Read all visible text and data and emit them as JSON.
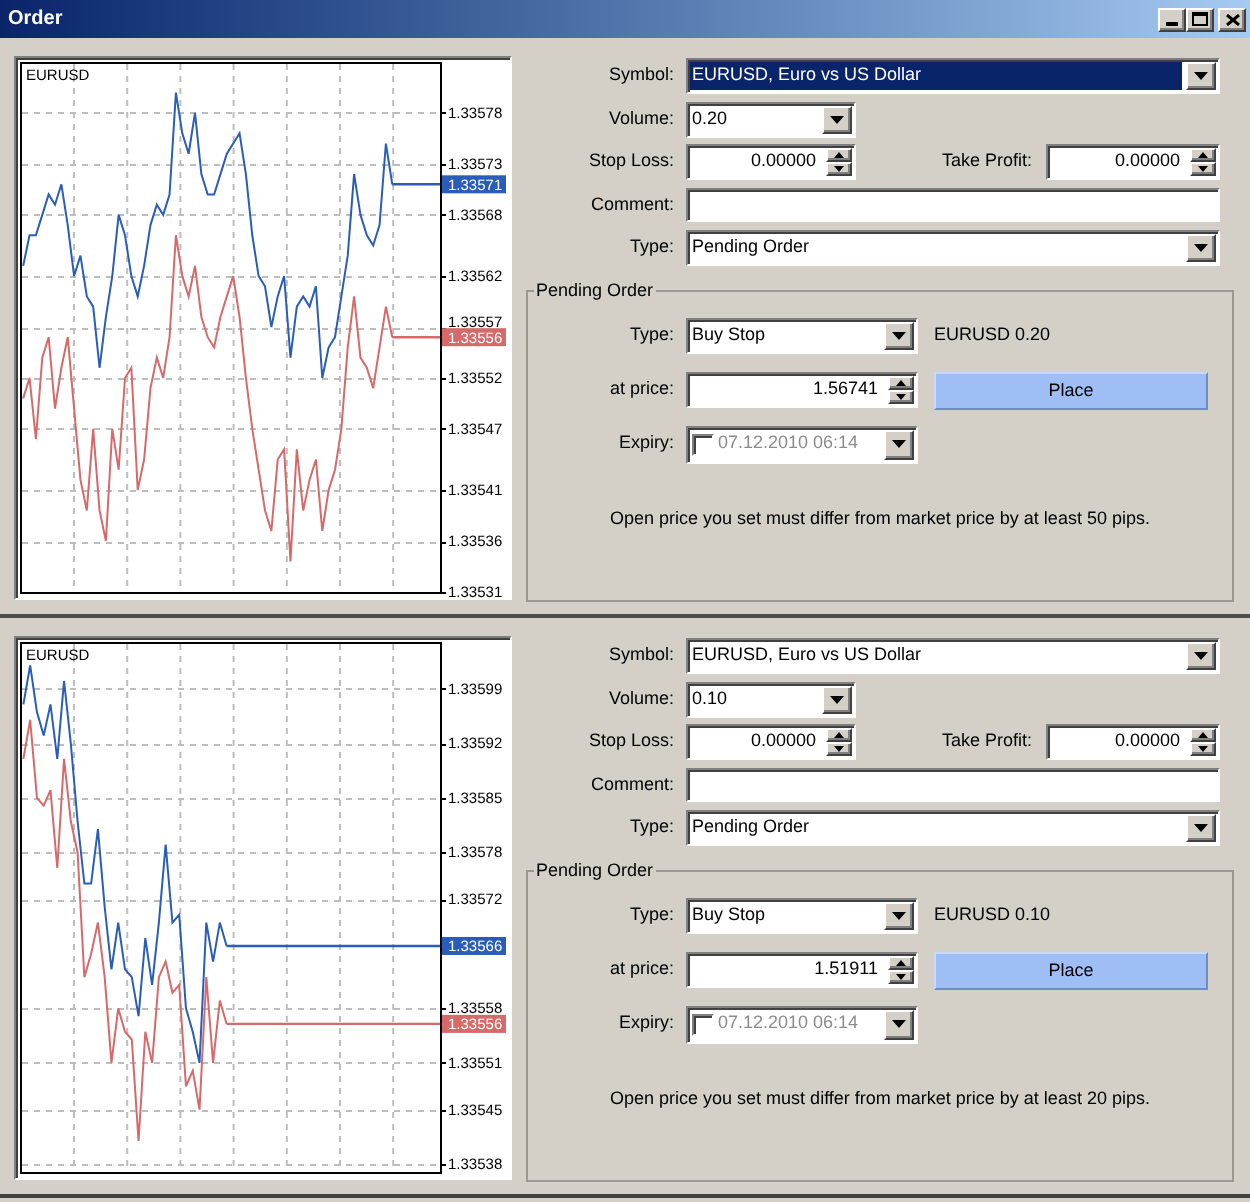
{
  "window": {
    "title": "Order"
  },
  "panels": [
    {
      "chart": {
        "chart_data": {
          "type": "line",
          "title": "EURUSD",
          "grid": true,
          "categories": [
            null,
            null,
            null,
            null,
            null,
            null,
            null,
            null,
            null,
            null,
            null,
            null,
            null,
            null,
            null,
            null,
            null,
            null,
            null,
            null,
            null,
            null,
            null,
            null,
            null,
            null,
            null,
            null,
            null,
            null,
            null,
            null,
            null,
            null,
            null,
            null,
            null,
            null,
            null,
            null,
            null,
            null,
            null,
            null,
            null,
            null,
            null,
            null,
            null,
            null,
            null,
            null,
            null,
            null,
            null,
            null,
            null,
            null,
            null,
            null,
            null,
            null,
            null,
            null,
            null,
            null
          ],
          "ylim": [
            1.33531,
            1.33583
          ],
          "yticks": [
            1.33578,
            1.33573,
            1.33568,
            1.33562,
            1.33557,
            1.33552,
            1.33547,
            1.33541,
            1.33536,
            1.33531
          ],
          "series": [
            {
              "color": "#2a5db8",
              "values": [
                1.33563,
                1.33566,
                1.33566,
                1.33568,
                1.3357,
                1.33569,
                1.33571,
                1.33567,
                1.33562,
                1.33564,
                1.3356,
                1.33559,
                1.33553,
                1.33558,
                1.33562,
                1.33568,
                1.33566,
                1.33562,
                1.3356,
                1.33563,
                1.33567,
                1.33569,
                1.33568,
                1.3357,
                1.3358,
                1.33576,
                1.33574,
                1.33578,
                1.33572,
                1.3357,
                1.3357,
                1.33572,
                1.33574,
                1.33575,
                1.33576,
                1.33572,
                1.33566,
                1.33562,
                1.33561,
                1.33557,
                1.3356,
                1.33562,
                1.33554,
                1.33559,
                1.3356,
                1.33559,
                1.33561,
                1.33552,
                1.33555,
                1.33556,
                1.3356,
                1.33564,
                1.33572,
                1.33568,
                1.33566,
                1.33565,
                1.33567,
                1.33575,
                1.33571,
                null,
                null,
                null,
                null,
                null,
                null,
                null
              ]
            },
            {
              "color": "#d66a6a",
              "values": [
                1.3355,
                1.33552,
                1.33546,
                1.33554,
                1.33556,
                1.33549,
                1.33553,
                1.33556,
                1.33549,
                1.33542,
                1.33539,
                1.33547,
                1.33539,
                1.33536,
                1.33547,
                1.33543,
                1.33552,
                1.33553,
                1.33541,
                1.33544,
                1.33551,
                1.33554,
                1.33552,
                1.33556,
                1.33566,
                1.33562,
                1.3356,
                1.33563,
                1.33558,
                1.33556,
                1.33555,
                1.33558,
                1.3356,
                1.33562,
                1.33558,
                1.33552,
                1.33547,
                1.33543,
                1.33539,
                1.33537,
                1.33544,
                1.33545,
                1.33534,
                1.33545,
                1.33539,
                1.33542,
                1.33544,
                1.33537,
                1.33541,
                1.33543,
                1.33547,
                1.33555,
                1.3356,
                1.33554,
                1.33553,
                1.33551,
                1.33555,
                1.33559,
                1.33556,
                null,
                null,
                null,
                null,
                null,
                null,
                null
              ]
            }
          ],
          "annotations": [
            "1.33571",
            "1.33556"
          ]
        }
      },
      "form": {
        "symbol": {
          "label": "Symbol:",
          "value": "EURUSD, Euro vs US Dollar",
          "highlighted": true
        },
        "volume": {
          "label": "Volume:",
          "value": "0.20"
        },
        "stop_loss": {
          "label": "Stop Loss:",
          "value": "0.00000"
        },
        "take_profit": {
          "label": "Take Profit:",
          "value": "0.00000"
        },
        "comment": {
          "label": "Comment:"
        },
        "type": {
          "label": "Type:",
          "value": "Pending Order"
        }
      },
      "pending_order": {
        "title": "Pending Order",
        "type": {
          "label": "Type:",
          "value": "Buy Stop"
        },
        "summary": "EURUSD 0.20",
        "price": {
          "label": "at price:",
          "value": "1.56741"
        },
        "place_button": "Place",
        "expiry": {
          "label": "Expiry:",
          "checked": false,
          "value": "07.12.2010 06:14"
        },
        "note": "Open price you set must differ from market price by at least 50 pips."
      }
    },
    {
      "chart": {
        "chart_data": {
          "type": "line",
          "title": "EURUSD",
          "grid": true,
          "categories": [
            null,
            null,
            null,
            null,
            null,
            null,
            null,
            null,
            null,
            null,
            null,
            null,
            null,
            null,
            null,
            null,
            null,
            null,
            null,
            null,
            null,
            null,
            null,
            null,
            null,
            null,
            null,
            null,
            null,
            null,
            null,
            null,
            null,
            null,
            null,
            null,
            null,
            null,
            null,
            null,
            null,
            null,
            null,
            null,
            null,
            null,
            null,
            null,
            null,
            null,
            null,
            null,
            null,
            null,
            null,
            null,
            null,
            null,
            null,
            null,
            null,
            null
          ],
          "ylim": [
            1.33537,
            1.33605
          ],
          "yticks": [
            1.33599,
            1.33592,
            1.33585,
            1.33578,
            1.33572,
            1.33558,
            1.33551,
            1.33545,
            1.33538
          ],
          "series": [
            {
              "color": "#2a5db8",
              "values": [
                1.33597,
                1.33602,
                1.33596,
                1.33593,
                1.33597,
                1.3359,
                1.336,
                1.33592,
                1.33582,
                1.33574,
                1.33574,
                1.33581,
                1.33571,
                1.33563,
                1.33569,
                1.33563,
                1.33562,
                1.33557,
                1.33567,
                1.33561,
                1.33569,
                1.33579,
                1.33569,
                1.3357,
                1.33558,
                1.33555,
                1.33551,
                1.33569,
                1.33564,
                1.33569,
                1.33566,
                null,
                null,
                null,
                null,
                null,
                null,
                null,
                null,
                null,
                null,
                null,
                null,
                null,
                null,
                null,
                null,
                null,
                null,
                null,
                null,
                null,
                null,
                null,
                null,
                null,
                null,
                null,
                null,
                null,
                null,
                null
              ]
            },
            {
              "color": "#d66a6a",
              "values": [
                1.3359,
                1.33595,
                1.33585,
                1.33584,
                1.33586,
                1.33576,
                1.3359,
                1.33582,
                1.33578,
                1.33562,
                1.33565,
                1.33569,
                1.33562,
                1.33551,
                1.33558,
                1.33555,
                1.33554,
                1.33541,
                1.33555,
                1.33551,
                1.33562,
                1.33564,
                1.3356,
                1.33561,
                1.33548,
                1.3355,
                1.33545,
                1.33562,
                1.33551,
                1.33559,
                1.33556,
                null,
                null,
                null,
                null,
                null,
                null,
                null,
                null,
                null,
                null,
                null,
                null,
                null,
                null,
                null,
                null,
                null,
                null,
                null,
                null,
                null,
                null,
                null,
                null,
                null,
                null,
                null,
                null,
                null,
                null,
                null
              ]
            }
          ],
          "annotations": [
            "1.33566",
            "1.33556"
          ]
        }
      },
      "form": {
        "symbol": {
          "label": "Symbol:",
          "value": "EURUSD, Euro vs US Dollar",
          "highlighted": false
        },
        "volume": {
          "label": "Volume:",
          "value": "0.10"
        },
        "stop_loss": {
          "label": "Stop Loss:",
          "value": "0.00000"
        },
        "take_profit": {
          "label": "Take Profit:",
          "value": "0.00000"
        },
        "comment": {
          "label": "Comment:"
        },
        "type": {
          "label": "Type:",
          "value": "Pending Order"
        }
      },
      "pending_order": {
        "title": "Pending Order",
        "type": {
          "label": "Type:",
          "value": "Buy Stop"
        },
        "summary": "EURUSD 0.10",
        "price": {
          "label": "at price:",
          "value": "1.51911"
        },
        "place_button": "Place",
        "expiry": {
          "label": "Expiry:",
          "checked": false,
          "value": "07.12.2010 06:14"
        },
        "note": "Open price you set must differ from market price by at least 20 pips."
      }
    }
  ]
}
